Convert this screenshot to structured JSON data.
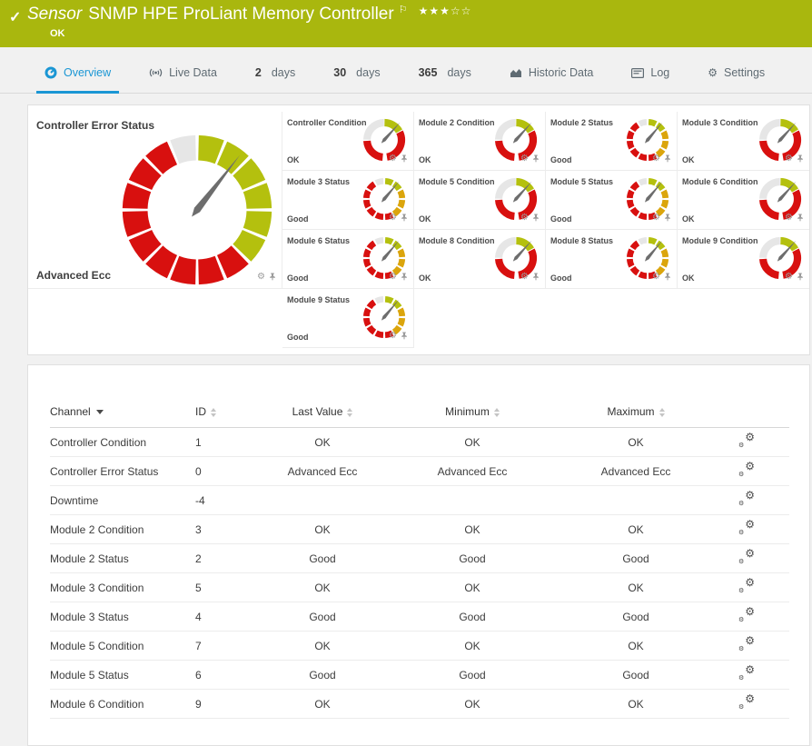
{
  "header": {
    "kind": "Sensor",
    "title": "SNMP HPE ProLiant Memory Controller",
    "status": "OK",
    "stars_filled": 3,
    "stars_total": 5
  },
  "tabs": [
    {
      "label": "Overview",
      "icon": "gauge-icon",
      "active": true
    },
    {
      "label": "Live Data",
      "icon": "live-icon",
      "active": false
    },
    {
      "prefix": "2",
      "label": "days",
      "active": false
    },
    {
      "prefix": "30",
      "label": "days",
      "active": false
    },
    {
      "prefix": "365",
      "label": "days",
      "active": false
    },
    {
      "label": "Historic Data",
      "icon": "chart-icon",
      "active": false
    },
    {
      "label": "Log",
      "icon": "log-icon",
      "active": false
    },
    {
      "label": "Settings",
      "icon": "gear-icon",
      "active": false
    }
  ],
  "overview": {
    "main_gauge": {
      "title": "Controller Error Status",
      "value": "Advanced Ecc",
      "type": "big"
    },
    "small_gauges": [
      {
        "title": "Controller Condition",
        "value": "OK",
        "type": "condition"
      },
      {
        "title": "Module 2 Condition",
        "value": "OK",
        "type": "condition"
      },
      {
        "title": "Module 2 Status",
        "value": "Good",
        "type": "status"
      },
      {
        "title": "Module 3 Condition",
        "value": "OK",
        "type": "condition"
      },
      {
        "title": "Module 3 Status",
        "value": "Good",
        "type": "status"
      },
      {
        "title": "Module 5 Condition",
        "value": "OK",
        "type": "condition"
      },
      {
        "title": "Module 5 Status",
        "value": "Good",
        "type": "status"
      },
      {
        "title": "Module 6 Condition",
        "value": "OK",
        "type": "condition"
      },
      {
        "title": "Module 6 Status",
        "value": "Good",
        "type": "status"
      },
      {
        "title": "Module 8 Condition",
        "value": "OK",
        "type": "condition"
      },
      {
        "title": "Module 8 Status",
        "value": "Good",
        "type": "status"
      },
      {
        "title": "Module 9 Condition",
        "value": "OK",
        "type": "condition"
      },
      {
        "title": "Module 9 Status",
        "value": "Good",
        "type": "status"
      }
    ]
  },
  "table": {
    "columns": [
      "Channel",
      "ID",
      "Last Value",
      "Minimum",
      "Maximum"
    ],
    "sorted_by": "Channel",
    "rows": [
      [
        "Controller Condition",
        "1",
        "OK",
        "OK",
        "OK"
      ],
      [
        "Controller Error Status",
        "0",
        "Advanced Ecc",
        "Advanced Ecc",
        "Advanced Ecc"
      ],
      [
        "Downtime",
        "-4",
        "",
        "",
        ""
      ],
      [
        "Module 2 Condition",
        "3",
        "OK",
        "OK",
        "OK"
      ],
      [
        "Module 2 Status",
        "2",
        "Good",
        "Good",
        "Good"
      ],
      [
        "Module 3 Condition",
        "5",
        "OK",
        "OK",
        "OK"
      ],
      [
        "Module 3 Status",
        "4",
        "Good",
        "Good",
        "Good"
      ],
      [
        "Module 5 Condition",
        "7",
        "OK",
        "OK",
        "OK"
      ],
      [
        "Module 5 Status",
        "6",
        "Good",
        "Good",
        "Good"
      ],
      [
        "Module 6 Condition",
        "9",
        "OK",
        "OK",
        "OK"
      ]
    ]
  },
  "colors": {
    "header_green": "#a9b70e",
    "accent_blue": "#1a96d4",
    "gauge_green": "#b4c00e",
    "gauge_red": "#d8100f",
    "gauge_yellow": "#dba50c",
    "gauge_gray": "#e6e6e6",
    "needle": "#6d6d6d"
  }
}
